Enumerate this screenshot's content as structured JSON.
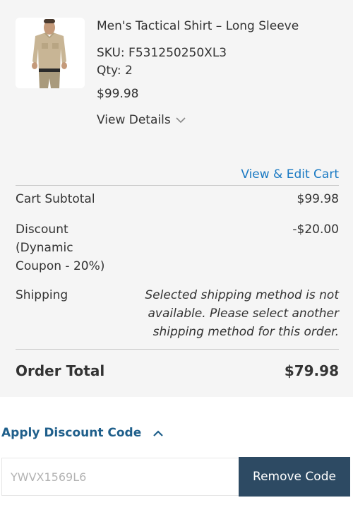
{
  "product": {
    "name": "Men's Tactical Shirt – Long Sleeve",
    "sku": "SKU: F531250250XL3",
    "qty": "Qty: 2",
    "price": "$99.98",
    "view_details_label": "View Details",
    "image_icon": "shirt-photo"
  },
  "cart_link": "View & Edit Cart",
  "totals": {
    "subtotal_label": "Cart Subtotal",
    "subtotal_value": "$99.98",
    "discount_label": "Discount (Dynamic Coupon - 20%)",
    "discount_value": "-$20.00",
    "shipping_label": "Shipping",
    "shipping_message": "Selected shipping method is not available. Please select another shipping method for this order.",
    "order_total_label": "Order Total",
    "order_total_value": "$79.98"
  },
  "discount_section": {
    "toggle_label": "Apply Discount Code",
    "code_value": "YWVX1569L6",
    "remove_button_label": "Remove Code"
  },
  "colors": {
    "link_blue": "#1979c3",
    "heading_blue": "#1f5f8b",
    "button_navy": "#2d4a63",
    "panel_bg": "#f5f5f5"
  }
}
